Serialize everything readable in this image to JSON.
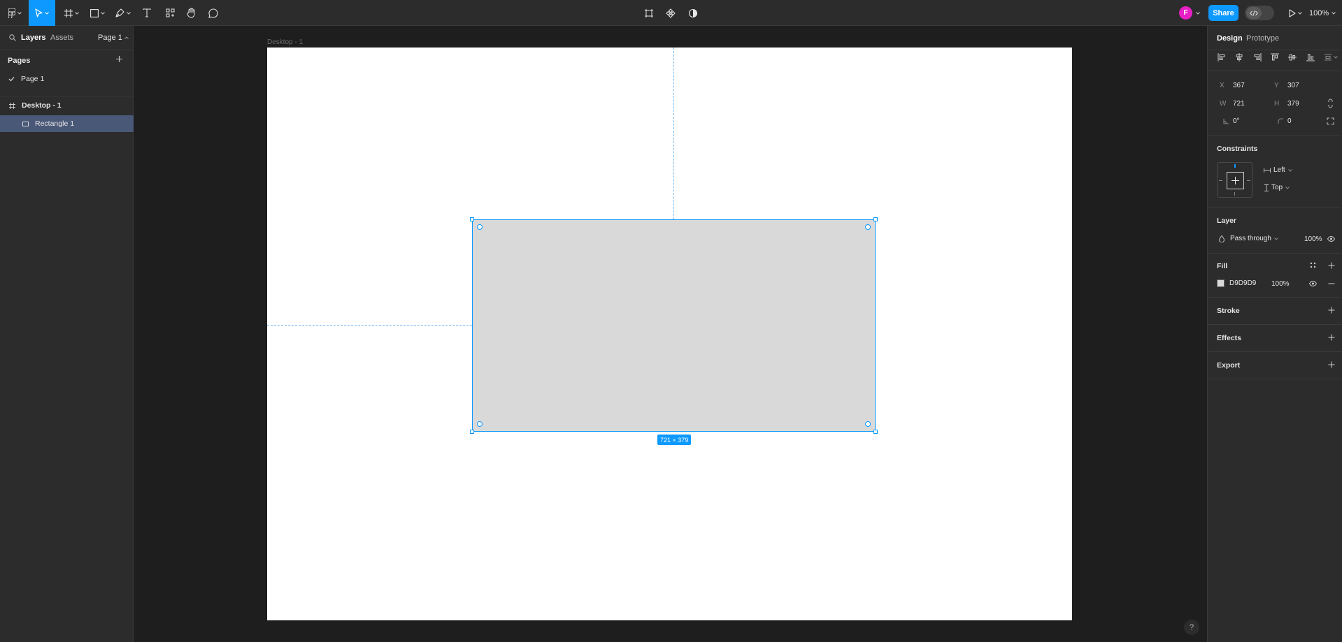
{
  "toolbar": {
    "share_label": "Share",
    "avatar_initial": "F",
    "zoom_label": "100%"
  },
  "left_panel": {
    "tab_layers": "Layers",
    "tab_assets": "Assets",
    "page_selector": "Page 1",
    "pages_heading": "Pages",
    "pages": [
      {
        "label": "Page 1",
        "selected": true
      }
    ],
    "layers": [
      {
        "label": "Desktop - 1",
        "type": "frame"
      },
      {
        "label": "Rectangle 1",
        "type": "rectangle",
        "selected": true
      }
    ]
  },
  "canvas": {
    "frame_label": "Desktop - 1",
    "selection_size": "721 × 379",
    "rect_fill": "#D9D9D9",
    "selection_color": "#0d99ff"
  },
  "right_panel": {
    "tab_design": "Design",
    "tab_prototype": "Prototype",
    "x_label": "X",
    "x_value": "367",
    "y_label": "Y",
    "y_value": "307",
    "w_label": "W",
    "w_value": "721",
    "h_label": "H",
    "h_value": "379",
    "rotation": "0°",
    "corner_radius": "0",
    "constraints_heading": "Constraints",
    "constraint_h": "Left",
    "constraint_v": "Top",
    "layer_heading": "Layer",
    "blend_mode": "Pass through",
    "layer_opacity": "100%",
    "fill_heading": "Fill",
    "fill_hex": "D9D9D9",
    "fill_opacity": "100%",
    "stroke_heading": "Stroke",
    "effects_heading": "Effects",
    "export_heading": "Export"
  },
  "help_label": "?"
}
